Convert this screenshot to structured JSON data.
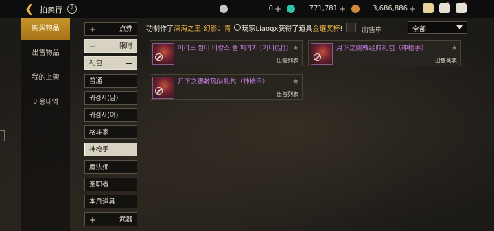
{
  "header": {
    "title": "拍卖行",
    "help": "?",
    "currencies": [
      {
        "icon": "silver-coin-icon",
        "value": "0",
        "plus": "+"
      },
      {
        "icon": "green-gem-icon",
        "value": "771,781",
        "plus": "+"
      },
      {
        "icon": "gold-coin-icon",
        "value": "3,686,886",
        "plus": "+"
      }
    ]
  },
  "nav": {
    "items": [
      "购买物品",
      "出售物品",
      "我的上架",
      "이용내역"
    ],
    "active": 0
  },
  "categories": {
    "coupon": {
      "sym": "+",
      "label": "点券"
    },
    "limited": {
      "sym": "−",
      "label": "限时"
    },
    "gift": {
      "label": "礼包"
    },
    "list": [
      "普通",
      "귀검사(남)",
      "귀검사(여)",
      "格斗家",
      "神枪手",
      "魔法师",
      "圣职者",
      "本月道具"
    ],
    "selected": "神枪手",
    "weapon": {
      "sym": "+",
      "label": "武器"
    }
  },
  "ticker": {
    "p1": "功制作了",
    "h1": "深海之王-幻影：青",
    "p2": "玩家Liaoqx获得了道具",
    "h2": "金罐奖杯",
    "p3": "!"
  },
  "filter": {
    "on_sale_label": "出售中",
    "dropdown_value": "全部"
  },
  "items": [
    {
      "name": "아라드 썸머 바캉스 풀 패키지 [거너(남)]",
      "list_label": "出售列表"
    },
    {
      "name": "月下之赐教经典礼包（神枪手）",
      "list_label": "出售列表"
    },
    {
      "name": "月下之赐教风尚礼包（神枪手）",
      "list_label": "出售列表"
    }
  ],
  "colors": {
    "accent": "#f0b743",
    "item_name": "#c77ee0",
    "nav_active": "#b8852a"
  }
}
